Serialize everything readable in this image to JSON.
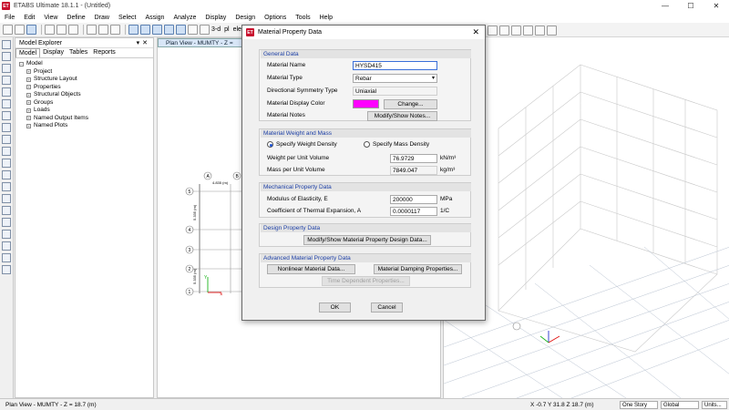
{
  "window": {
    "title": "ETABS Ultimate 18.1.1 - (Untitled)",
    "logo_text": "ET"
  },
  "menu": [
    "File",
    "Edit",
    "View",
    "Define",
    "Draw",
    "Select",
    "Assign",
    "Analyze",
    "Display",
    "Design",
    "Options",
    "Tools",
    "Help"
  ],
  "toolbar": {
    "view_3d": "3-d",
    "view_pl": "pl",
    "view_elev": "elev"
  },
  "explorer": {
    "title": "Model Explorer",
    "tabs": [
      "Model",
      "Display",
      "Tables",
      "Reports"
    ],
    "root": "Model",
    "items": [
      "Project",
      "Structure Layout",
      "Properties",
      "Structural Objects",
      "Groups",
      "Loads",
      "Named Output Items",
      "Named Plots"
    ]
  },
  "planview": {
    "tab_label": "Plan View - MUMTY - Z =",
    "grid_labels": [
      "A",
      "B",
      "5",
      "4",
      "3",
      "2",
      "1"
    ],
    "dims": [
      "4.835 (m)",
      "5.335 (m)",
      "5.335 (m)"
    ]
  },
  "status": {
    "left": "Plan View - MUMTY - Z = 18.7 (m)",
    "coords": "X -0.7  Y 31.8  Z 18.7 (m)",
    "story": "One Story",
    "system": "Global",
    "units": "Units..."
  },
  "dialog": {
    "title": "Material Property Data",
    "general": {
      "heading": "General Data",
      "name_label": "Material Name",
      "name_value": "HYSD415",
      "type_label": "Material Type",
      "type_value": "Rebar",
      "symmetry_label": "Directional Symmetry Type",
      "symmetry_value": "Uniaxial",
      "color_label": "Material Display Color",
      "color_value": "#ff00ff",
      "change_button": "Change...",
      "notes_label": "Material Notes",
      "notes_button": "Modify/Show Notes..."
    },
    "weight": {
      "heading": "Material Weight and Mass",
      "opt_weight": "Specify Weight Density",
      "opt_mass": "Specify Mass Density",
      "wpuv_label": "Weight per Unit Volume",
      "wpuv_value": "76.9729",
      "wpuv_unit": "kN/m³",
      "mpuv_label": "Mass per Unit Volume",
      "mpuv_value": "7849.047",
      "mpuv_unit": "kg/m³"
    },
    "mechanical": {
      "heading": "Mechanical Property Data",
      "e_label": "Modulus of Elasticity,  E",
      "e_value": "200000",
      "e_unit": "MPa",
      "a_label": "Coefficient of Thermal Expansion,  A",
      "a_value": "0.0000117",
      "a_unit": "1/C"
    },
    "design": {
      "heading": "Design Property Data",
      "button": "Modify/Show Material Property Design Data..."
    },
    "advanced": {
      "heading": "Advanced Material Property Data",
      "nonlinear_button": "Nonlinear Material Data...",
      "damping_button": "Material Damping Properties...",
      "time_button": "Time Dependent Properties..."
    },
    "ok": "OK",
    "cancel": "Cancel"
  }
}
